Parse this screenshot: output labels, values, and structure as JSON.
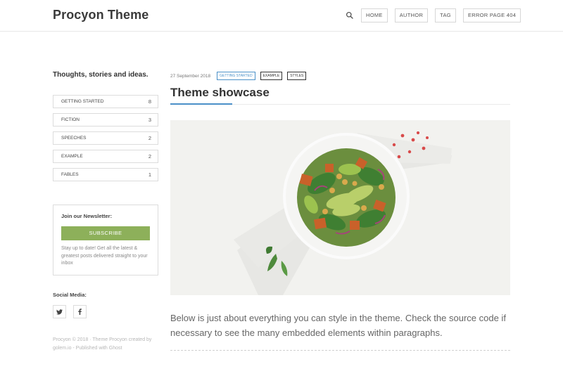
{
  "header": {
    "brand": "Procyon Theme",
    "nav": [
      "HOME",
      "AUTHOR",
      "TAG",
      "ERROR PAGE 404"
    ]
  },
  "sidebar": {
    "tagline": "Thoughts, stories and ideas.",
    "categories": [
      {
        "label": "GETTING STARTED",
        "count": "8"
      },
      {
        "label": "FICTION",
        "count": "3"
      },
      {
        "label": "SPEECHES",
        "count": "2"
      },
      {
        "label": "EXAMPLE",
        "count": "2"
      },
      {
        "label": "FABLES",
        "count": "1"
      }
    ],
    "newsletter": {
      "title": "Join our Newsletter:",
      "button": "SUBSCRIBE",
      "text": "Stay up to date! Get all the latest & greatest posts delivered straight to your inbox"
    },
    "social_label": "Social Media:",
    "social_icons": [
      "twitter-icon",
      "facebook-icon"
    ],
    "footer": "Procyon © 2018 · Theme Procyon created by golem.io - Published with Ghost"
  },
  "post": {
    "date": "27 September 2018",
    "tags": [
      "GETTING STARTED",
      "EXAMPLE",
      "STYLES"
    ],
    "title": "Theme showcase",
    "excerpt": "Below is just about everything you can style in the theme. Check the source code if necessary to see the many embedded elements within paragraphs."
  },
  "colors": {
    "accent": "#4a90c8",
    "subscribe": "#8db05a"
  }
}
